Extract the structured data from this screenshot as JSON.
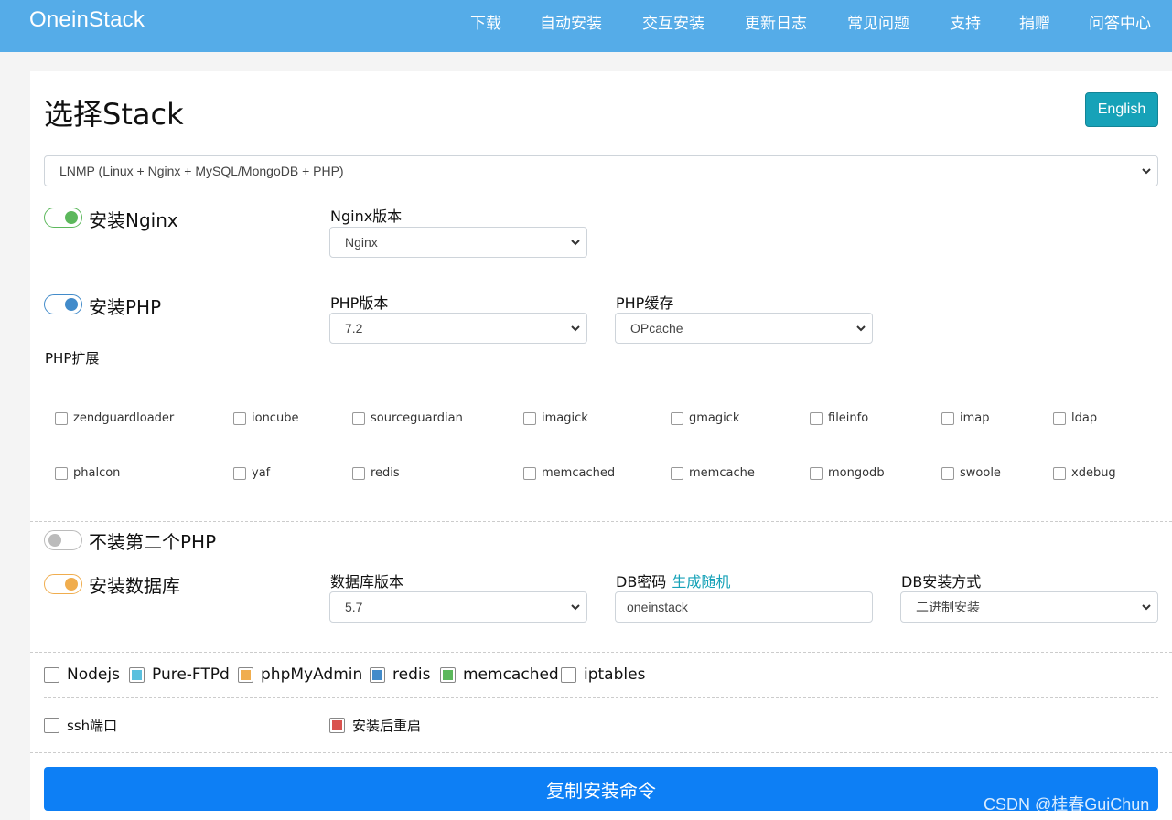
{
  "nav": {
    "brand": "OneinStack",
    "items": [
      "下载",
      "自动安装",
      "交互安装",
      "更新日志",
      "常见问题",
      "支持",
      "捐赠",
      "问答中心"
    ]
  },
  "header": {
    "title": "选择Stack",
    "language_button": "English"
  },
  "stack_select": {
    "value": "LNMP (Linux + Nginx + MySQL/MongoDB + PHP)"
  },
  "nginx": {
    "switch_label": "安装Nginx",
    "switch_on": true,
    "color": "#5cb85c",
    "version_label": "Nginx版本",
    "version_value": "Nginx"
  },
  "php": {
    "switch_label": "安装PHP",
    "switch_on": true,
    "color": "#428bca",
    "version_label": "PHP版本",
    "version_value": "7.2",
    "cache_label": "PHP缓存",
    "cache_value": "OPcache",
    "extensions_label": "PHP扩展",
    "extensions": [
      [
        "zendguardloader",
        "ioncube",
        "sourceguardian",
        "imagick",
        "gmagick",
        "fileinfo",
        "imap",
        "ldap"
      ],
      [
        "phalcon",
        "yaf",
        "redis",
        "memcached",
        "memcache",
        "mongodb",
        "swoole",
        "xdebug"
      ]
    ]
  },
  "php2": {
    "switch_label": "不装第二个PHP",
    "switch_on": false,
    "color": "#bbbbbb"
  },
  "database": {
    "switch_label": "安装数据库",
    "switch_on": true,
    "color": "#f0ad4e",
    "version_label": "数据库版本",
    "version_value": "5.7",
    "password_label": "DB密码",
    "password_link": "生成随机",
    "password_value": "oneinstack",
    "install_method_label": "DB安装方式",
    "install_method_value": "二进制安装"
  },
  "addons": [
    {
      "label": "Nodejs",
      "checked": false,
      "color": ""
    },
    {
      "label": "Pure-FTPd",
      "checked": true,
      "color": "#5bc0de"
    },
    {
      "label": "phpMyAdmin",
      "checked": true,
      "color": "#f0ad4e"
    },
    {
      "label": "redis",
      "checked": true,
      "color": "#428bca"
    },
    {
      "label": "memcached",
      "checked": true,
      "color": "#5cb85c"
    },
    {
      "label": "iptables",
      "checked": false,
      "color": ""
    }
  ],
  "ssh_port": {
    "label": "ssh端口",
    "checked": false
  },
  "reboot": {
    "label": "安装后重启",
    "checked": true,
    "color": "#d9534f"
  },
  "copy_button": "复制安装命令",
  "watermark": "CSDN @桂春GuiChun"
}
